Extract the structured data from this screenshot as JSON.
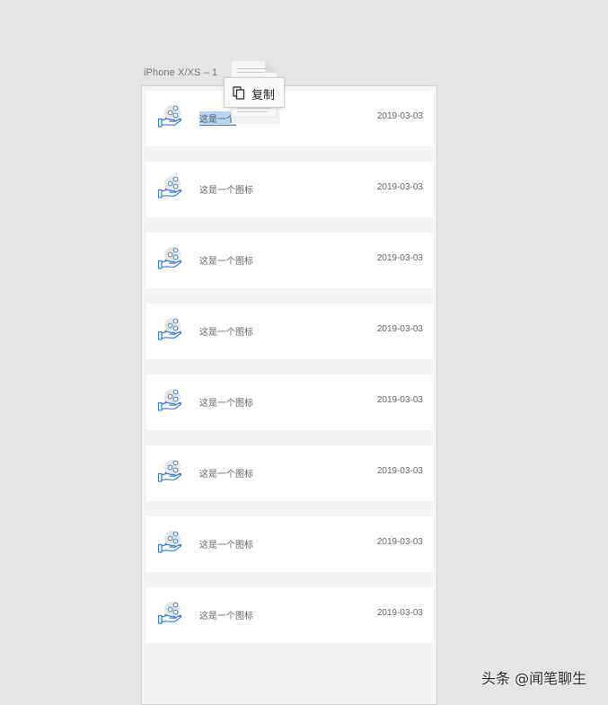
{
  "artboard": {
    "title": "iPhone X/XS – 1"
  },
  "list": {
    "items": [
      {
        "label": "这是一个图标",
        "date": "2019-03-03",
        "icon": "hand-coins-icon"
      },
      {
        "label": "这是一个图标",
        "date": "2019-03-03",
        "icon": "hand-coins-icon"
      },
      {
        "label": "这是一个图标",
        "date": "2019-03-03",
        "icon": "hand-coins-icon"
      },
      {
        "label": "这是一个图标",
        "date": "2019-03-03",
        "icon": "hand-coins-icon"
      },
      {
        "label": "这是一个图标",
        "date": "2019-03-03",
        "icon": "hand-coins-icon"
      },
      {
        "label": "这是一个图标",
        "date": "2019-03-03",
        "icon": "hand-coins-icon"
      },
      {
        "label": "这是一个图标",
        "date": "2019-03-03",
        "icon": "hand-coins-icon"
      },
      {
        "label": "这是一个图标",
        "date": "2019-03-03",
        "icon": "hand-coins-icon"
      }
    ],
    "selected_label_visible": "这是一个"
  },
  "context_tooltip": {
    "label": "复制",
    "icon": "copy-icon"
  },
  "watermark": {
    "text": "头条 @闻笔聊生"
  },
  "colors": {
    "canvas": "#e5e5e5",
    "artboard": "#f4f4f4",
    "row": "#ffffff",
    "icon_blue": "#3a7fd5",
    "selection": "#b5d6f7"
  }
}
